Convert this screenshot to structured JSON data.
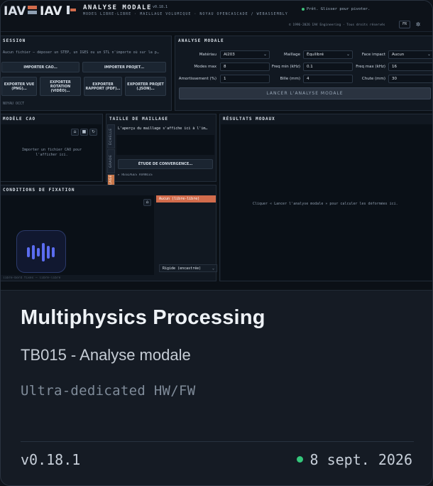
{
  "app": {
    "logo_primary": "IAV",
    "logo_secondary": "IAV",
    "title": "ANALYSE MODALE",
    "version_small": "v0.18.1",
    "subtitle": "MODES LIBRE-LIBRE · MAILLAGE VOLUMIQUE · NOYAU OPENCASCADE / WEBASSEMBLY",
    "status": "Prêt. Glisser pour pivoter.",
    "copyright": "© 1996-2026 IAV Engineering · Tous droits réservés",
    "lang": "FR",
    "colors": {
      "accent": "#d26c4c",
      "badge": "#5b6cf0",
      "status_ok": "#34c77b"
    }
  },
  "session": {
    "title": "SESSION",
    "hint": "Aucun fichier — déposer un STEP, un IGES ou un STL n'importe où sur la p…",
    "buttons": {
      "import_cad": "IMPORTER CAO…",
      "import_project": "IMPORTER PROJET…",
      "export_view": "EXPORTER VUE (PNG)…",
      "export_rotation": "EXPORTER ROTATION (VIDÉO)…",
      "export_report": "EXPORTER RAPPORT (PDF)…",
      "export_project": "EXPORTER PROJET (.JSON)…"
    },
    "footer": "NOYAU OCCT"
  },
  "modal": {
    "title": "ANALYSE MODALE",
    "material_label": "Matériau",
    "material_value": "Al203",
    "mesh_label": "Maillage",
    "mesh_value": "Équilibré",
    "face_label": "Face impact",
    "face_value": "Aucun",
    "modes_label": "Modes max",
    "modes_value": "8",
    "fmin_label": "Freq min (kHz)",
    "fmin_value": "0.1",
    "fmax_label": "Freq max (kHz)",
    "fmax_value": "16",
    "damping_label": "Amortissement (%)",
    "damping_value": "1",
    "bead_label": "Bille (mm)",
    "bead_value": "4",
    "drop_label": "Chute (mm)",
    "drop_value": "30",
    "run_label": "LANCER L'ANALYSE MODALE"
  },
  "cad_model": {
    "title": "MODÈLE CAO",
    "placeholder": "Importer un fichier CAO pour l'afficher ici."
  },
  "mesh_size": {
    "title": "TAILLE DE MAILLAGE",
    "hint": "L'aperçu du maillage s'affiche ici à l'im…",
    "tabs": [
      "ÉCHELLE",
      "GRADE",
      "RÉGLAGE"
    ],
    "convergence_button": "ÉTUDE DE CONVERGENCE…",
    "advanced": "▸ RÉGLAGES AVANCÉS"
  },
  "results": {
    "title": "RÉSULTATS MODAUX",
    "hint": "Cliquer « Lancer l'analyse modale » pour calculer les déformées ici."
  },
  "fixation": {
    "title": "CONDITIONS DE FIXATION",
    "option_active": "Aucun (libre-libre)",
    "option_rigid": "Rigide (encastrée)",
    "footer": "libre-bord fixes — libre-libre"
  },
  "card": {
    "title": "Multiphysics Processing",
    "subtitle": "TB015 - Analyse modale",
    "tagline": "Ultra-dedicated HW/FW",
    "version": "v0.18.1",
    "date": "8 sept. 2026",
    "badge_icon": "audio-waveform-icon"
  }
}
